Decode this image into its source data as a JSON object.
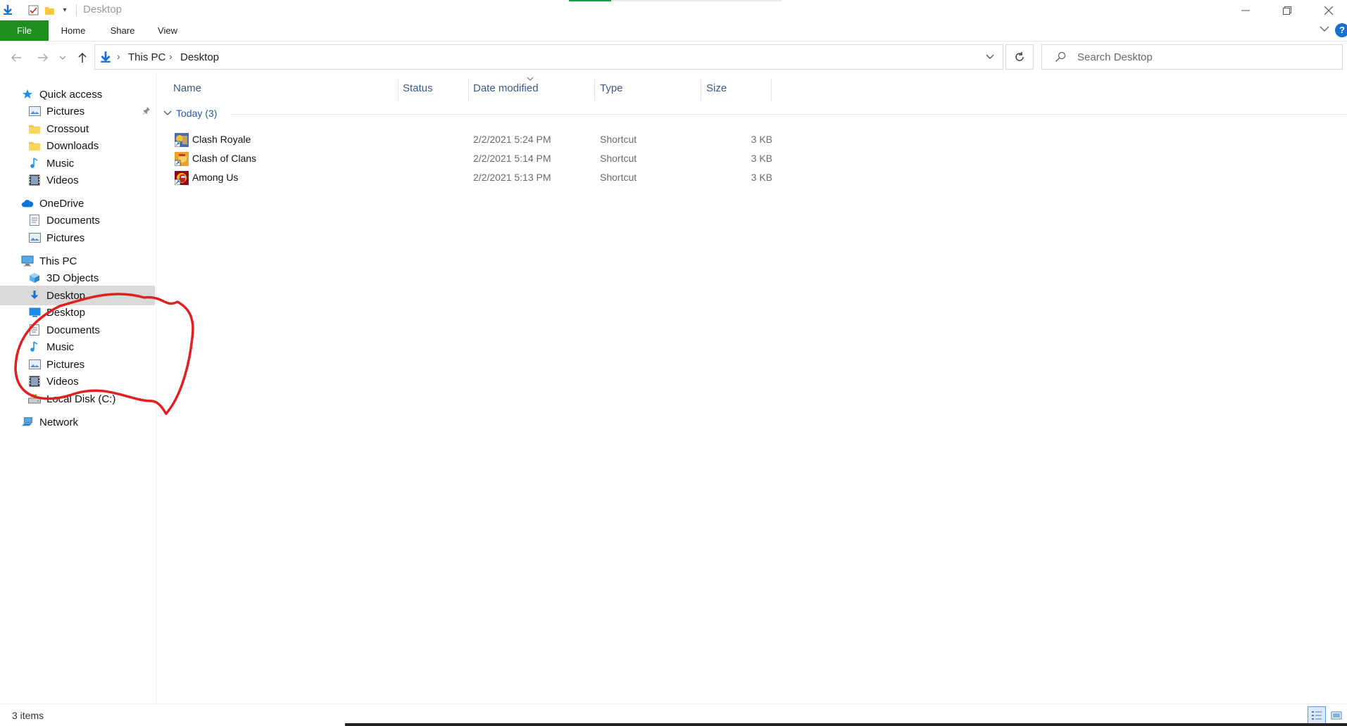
{
  "window": {
    "title": "Desktop",
    "progress_fraction": 0.2
  },
  "ribbon": {
    "tabs": [
      "File",
      "Home",
      "Share",
      "View"
    ],
    "help_glyph": "?"
  },
  "address": {
    "crumbs": [
      "This PC",
      "Desktop"
    ],
    "search_placeholder": "Search Desktop"
  },
  "sidebar": {
    "items": [
      {
        "label": "Quick access",
        "icon": "star-icon",
        "level": 0
      },
      {
        "label": "Pictures",
        "icon": "pictures-icon",
        "level": 1,
        "pinned": true
      },
      {
        "label": "Crossout",
        "icon": "folder-icon",
        "level": 1
      },
      {
        "label": "Downloads",
        "icon": "folder-icon",
        "level": 1
      },
      {
        "label": "Music",
        "icon": "music-icon",
        "level": 1
      },
      {
        "label": "Videos",
        "icon": "videos-icon",
        "level": 1
      },
      {
        "label": "OneDrive",
        "icon": "cloud-icon",
        "level": 0
      },
      {
        "label": "Documents",
        "icon": "documents-icon",
        "level": 1
      },
      {
        "label": "Pictures",
        "icon": "pictures-icon",
        "level": 1
      },
      {
        "label": "This PC",
        "icon": "computer-icon",
        "level": 0
      },
      {
        "label": "3D Objects",
        "icon": "cube-icon",
        "level": 1
      },
      {
        "label": "Desktop",
        "icon": "download-arrow-icon",
        "level": 1,
        "selected": true
      },
      {
        "label": "Desktop",
        "icon": "desktop-icon",
        "level": 1
      },
      {
        "label": "Documents",
        "icon": "documents-icon",
        "level": 1
      },
      {
        "label": "Music",
        "icon": "music-icon",
        "level": 1
      },
      {
        "label": "Pictures",
        "icon": "pictures-icon",
        "level": 1
      },
      {
        "label": "Videos",
        "icon": "videos-icon",
        "level": 1
      },
      {
        "label": "Local Disk (C:)",
        "icon": "drive-icon",
        "level": 1
      },
      {
        "label": "Network",
        "icon": "network-icon",
        "level": 0
      }
    ]
  },
  "columns": {
    "name": "Name",
    "status": "Status",
    "date_modified": "Date modified",
    "type": "Type",
    "size": "Size"
  },
  "group": {
    "label": "Today (3)"
  },
  "files": [
    {
      "name": "Clash Royale",
      "date": "2/2/2021 5:24 PM",
      "type": "Shortcut",
      "size": "3 KB"
    },
    {
      "name": "Clash of Clans",
      "date": "2/2/2021 5:14 PM",
      "type": "Shortcut",
      "size": "3 KB"
    },
    {
      "name": "Among Us",
      "date": "2/2/2021 5:13 PM",
      "type": "Shortcut",
      "size": "3 KB"
    }
  ],
  "status": {
    "item_count": "3 items"
  },
  "colors": {
    "file_tab": "#1e8f1e",
    "selection": "#d9d9d9",
    "accent_blue": "#1a6fd1",
    "annotation_red": "#e02020"
  }
}
